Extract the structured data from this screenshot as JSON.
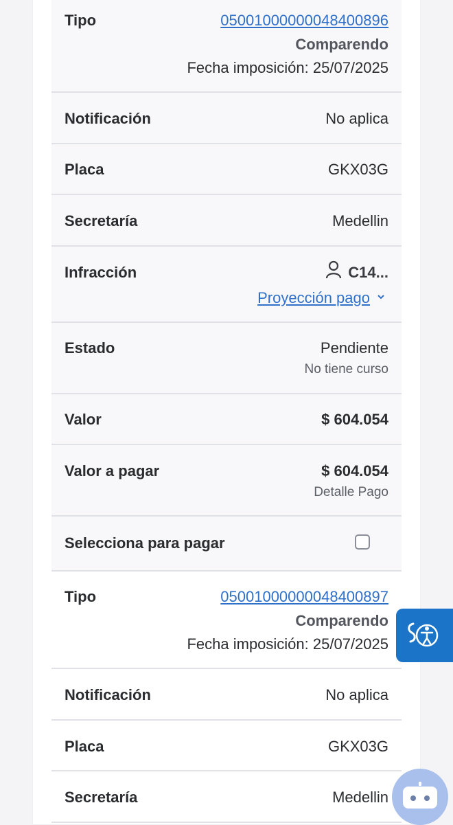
{
  "records": [
    {
      "tipo_label": "Tipo",
      "tipo_number": "05001000000048400896",
      "tipo_kind": "Comparendo",
      "fecha": "Fecha imposición: 25/07/2025",
      "notificacion_label": "Notificación",
      "notificacion_value": "No aplica",
      "placa_label": "Placa",
      "placa_value": "GKX03G",
      "secretaria_label": "Secretaría",
      "secretaria_value": "Medellin",
      "infraccion_label": "Infracción",
      "infraccion_value": "C14...",
      "proyeccion_label": "Proyección pago",
      "estado_label": "Estado",
      "estado_value": "Pendiente",
      "estado_sub": "No tiene curso",
      "valor_label": "Valor",
      "valor_value": "$ 604.054",
      "valor_pagar_label": "Valor a pagar",
      "valor_pagar_value": "$ 604.054",
      "detalle_pago": "Detalle Pago",
      "selecciona_label": "Selecciona para pagar"
    },
    {
      "tipo_label": "Tipo",
      "tipo_number": "05001000000048400897",
      "tipo_kind": "Comparendo",
      "fecha": "Fecha imposición: 25/07/2025",
      "notificacion_label": "Notificación",
      "notificacion_value": "No aplica",
      "placa_label": "Placa",
      "placa_value": "GKX03G",
      "secretaria_label": "Secretaría",
      "secretaria_value": "Medellin"
    }
  ],
  "icons": {
    "infraccion": "user-icon",
    "proyeccion": "chevron-down-icon",
    "accessibility": "accessibility-icon",
    "chatbot": "robot-icon"
  },
  "colors": {
    "link": "#2f70c9",
    "accessibility_button": "#1b74c8",
    "chatbot_button": "#a9c0ec"
  }
}
